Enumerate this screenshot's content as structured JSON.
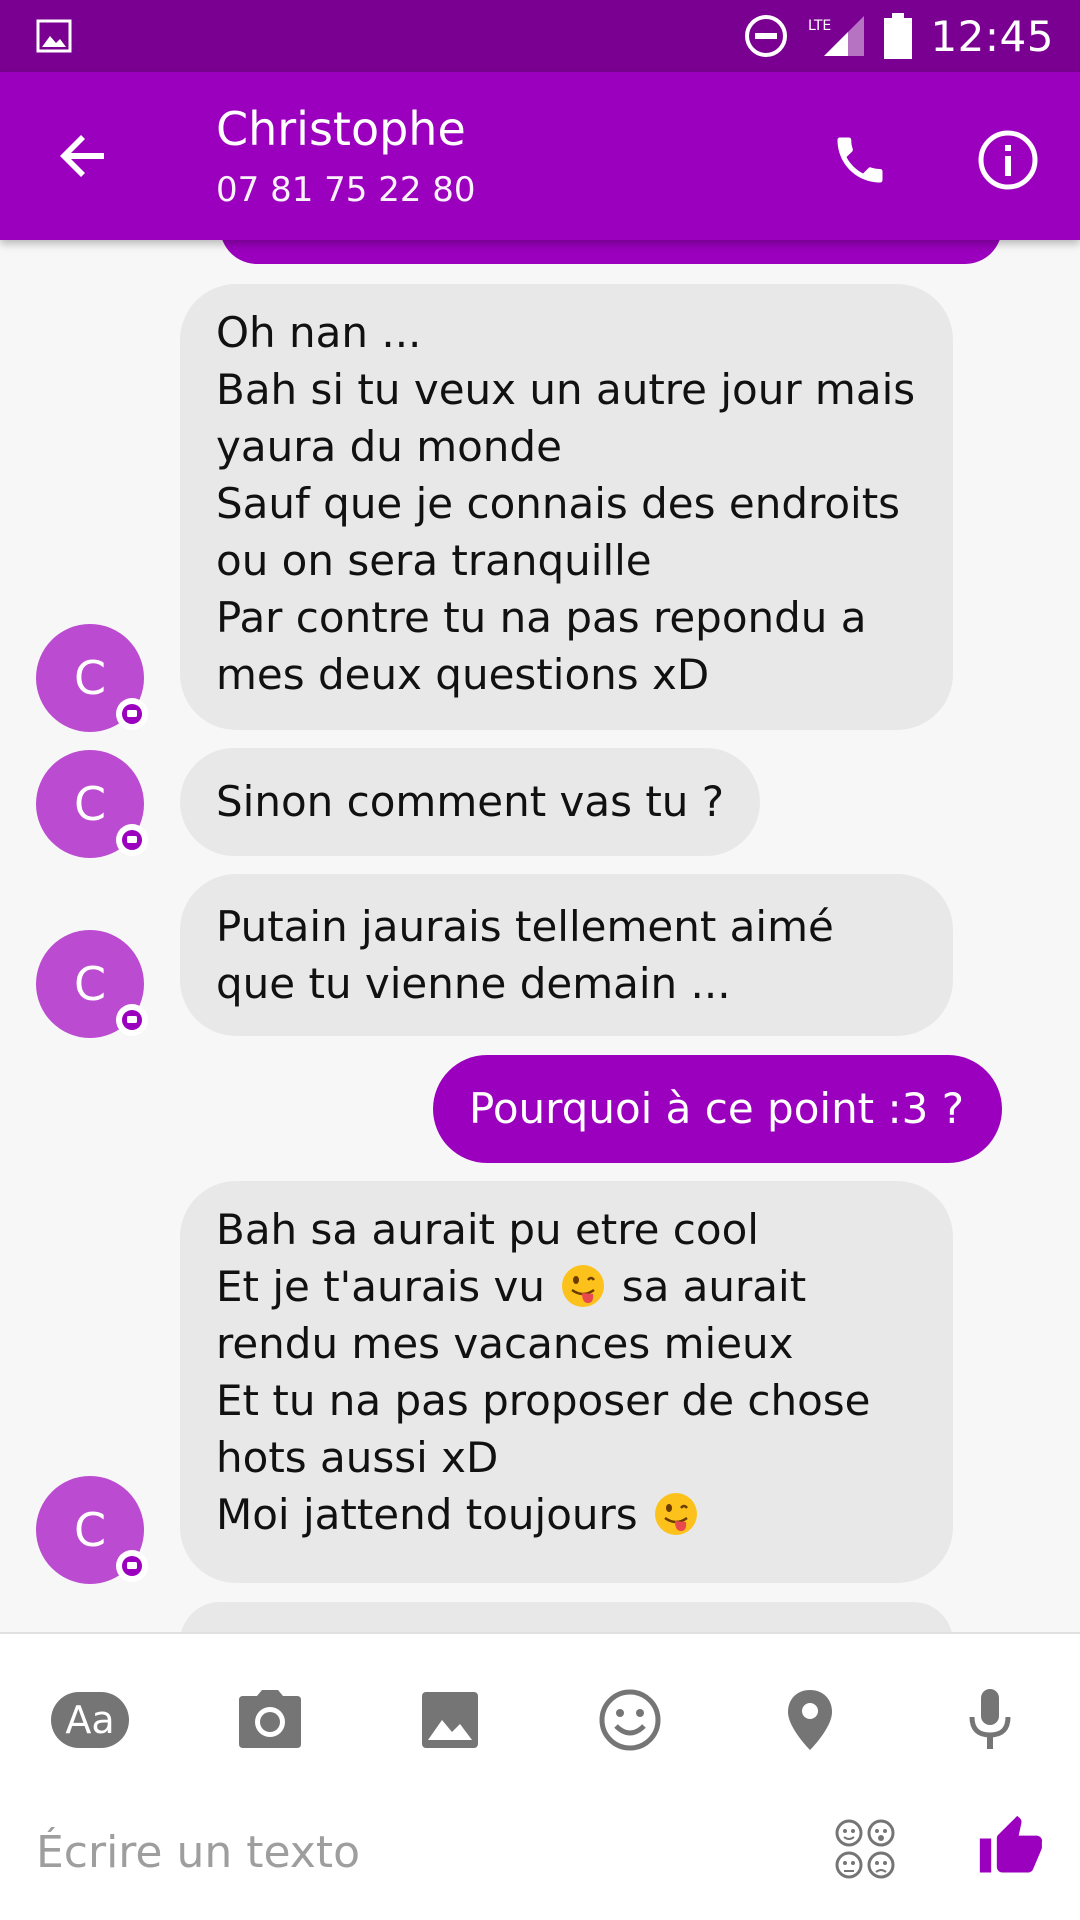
{
  "status_bar": {
    "time": "12:45",
    "network": "LTE",
    "icons": [
      "gallery-icon",
      "do-not-disturb-icon",
      "signal-icon",
      "battery-icon"
    ]
  },
  "header": {
    "contact_name": "Christophe",
    "phone_number": "07 81 75 22 80",
    "icons": [
      "back-arrow-icon",
      "phone-icon",
      "info-icon"
    ]
  },
  "conversation": {
    "avatar_initial": "C",
    "messages": [
      {
        "direction": "incoming",
        "lines": [
          "Oh nan ...",
          "Bah si tu veux un autre jour mais",
          "yaura du monde",
          "Sauf que je connais des endroits",
          "ou on sera tranquille",
          "Par contre tu na pas repondu a",
          "mes deux questions xD"
        ]
      },
      {
        "direction": "incoming",
        "lines": [
          "Sinon comment vas tu ?"
        ]
      },
      {
        "direction": "incoming",
        "lines": [
          "Putain jaurais tellement aimé",
          "que tu vienne demain ..."
        ]
      },
      {
        "direction": "outgoing",
        "lines": [
          "Pourquoi à ce point :3 ?"
        ]
      },
      {
        "direction": "incoming",
        "lines": [
          "Bah sa aurait pu etre cool",
          "Et je t'aurais vu",
          "sa aurait",
          "rendu mes vacances mieux",
          "Et tu na pas proposer de chose",
          "hots aussi xD",
          "Moi jattend toujours"
        ],
        "emojis": [
          "tongue-out-emoji",
          "tongue-out-emoji"
        ]
      }
    ]
  },
  "composer": {
    "placeholder": "Écrire un texto",
    "aa_label": "Aa",
    "tools": [
      "text-format-icon",
      "camera-icon",
      "image-icon",
      "emoji-icon",
      "location-icon",
      "microphone-icon"
    ],
    "stickers_icon": "stickers-icon",
    "send_icon": "thumbs-up-icon"
  },
  "colors": {
    "status_bar": "#7a0091",
    "app_bar": "#9a00bd",
    "outgoing_bubble": "#9a00bd",
    "incoming_bubble": "#e8e8e8",
    "avatar": "#bb4bd0",
    "background": "#f7f7f7",
    "icon_gray": "#757575"
  }
}
